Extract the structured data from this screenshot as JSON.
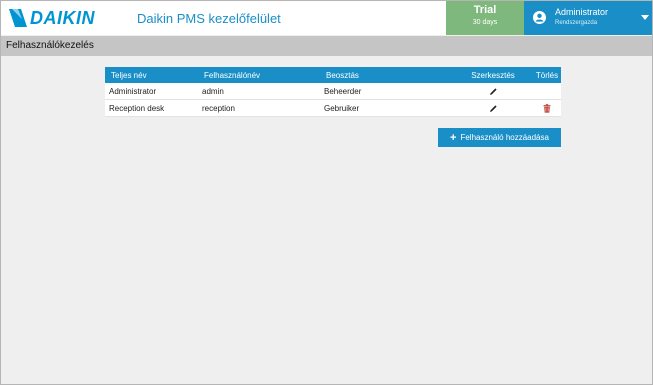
{
  "header": {
    "logo_text": "DAIKIN",
    "app_title": "Daikin PMS kezelőfelület",
    "trial_title": "Trial",
    "trial_days": "30 days",
    "user_name": "Administrator",
    "user_role": "Rendszergazda"
  },
  "page": {
    "title": "Felhasználókezelés"
  },
  "table": {
    "columns": [
      "Teljes név",
      "Felhasználónév",
      "Beosztás",
      "Szerkesztés",
      "Törlés"
    ],
    "rows": [
      {
        "full_name": "Administrator",
        "username": "admin",
        "role": "Beheerder",
        "deletable": false
      },
      {
        "full_name": "Reception desk",
        "username": "reception",
        "role": "Gebruiker",
        "deletable": true
      }
    ]
  },
  "add_button": {
    "label": "Felhasználó hozzáadása"
  },
  "colors": {
    "accent": "#1a8fc7",
    "trial": "#7eb87c",
    "page_bar": "#c5c5c5",
    "delete_icon": "#c0392b"
  },
  "icons": {
    "edit": "pencil-icon",
    "delete": "trash-icon",
    "add": "plus-icon",
    "user": "user-icon",
    "menu": "chevron-down-icon"
  }
}
